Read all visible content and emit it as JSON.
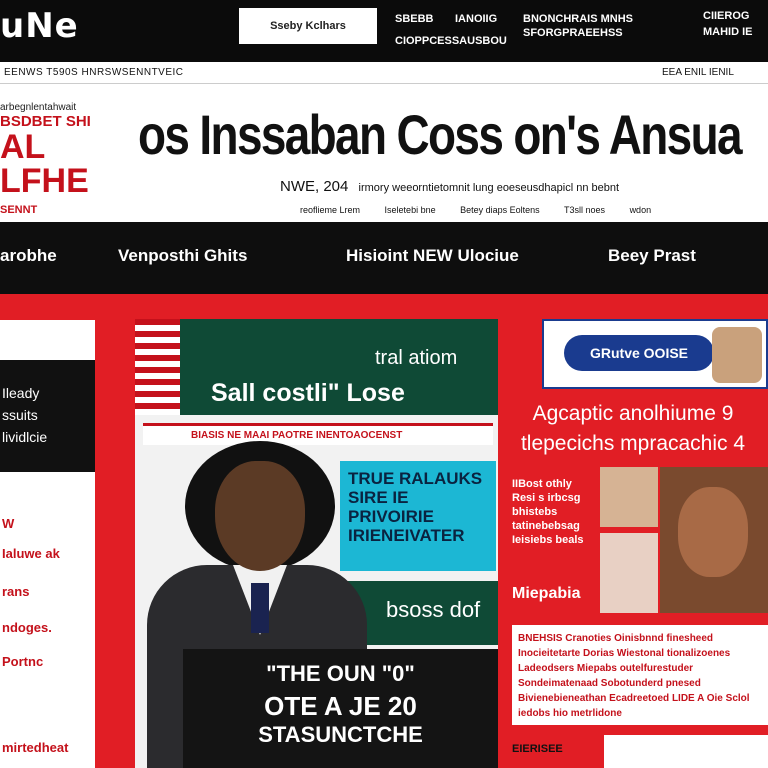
{
  "topbar": {
    "logo": "uNe",
    "search_placeholder": "Sseby Kclhars",
    "links": [
      "SBEBB",
      "IANOIIG",
      "BNONCHRAIS MNHS",
      "SFORGPRAEEHSS",
      "CIOPPCESSAUSBOU"
    ],
    "right": [
      "CIIEROG",
      "MAHID IE"
    ]
  },
  "utility": {
    "left": "EENWS   T590S   HNRSWSENNTVEIC",
    "right": "EEA  ENIL  IENIL"
  },
  "masthead": {
    "brand_small": "arbegnlentahwait",
    "brand_line": "BSDBET SHI",
    "brand_big": "AL LFHE",
    "brand_tag": "SENNT",
    "headline": "os Inssaban Coss on's Ansua",
    "dateline": "NWE, 204",
    "dateline_sub": "irmory weeorntietomnit lung eoeseusdhapicl nn bebnt",
    "sublinks": [
      "reoflieme Lrem",
      "Iseletebi bne",
      "Betey diaps Eoltens",
      "T3sll noes",
      "wdon"
    ]
  },
  "nav": [
    "arobhe",
    "Venposthi Ghits",
    "Hisioint NEW Ulociue",
    "Beey Prast"
  ],
  "left_column": {
    "block_lines": [
      "Ileady",
      "ssuits",
      "lividlcie"
    ],
    "items": [
      "W",
      "Ialuwe ak",
      "rans",
      "ndoges.",
      "Portnc",
      "mirtedheat"
    ]
  },
  "feature": {
    "kicker": "tral atiom",
    "title": "Sall costli\" Lose",
    "strip": "BIASIS NE MAAI PAOTRE   INENTOAOCENST",
    "cyan_text": "TRUE RALAUKS SIRE IE PRIVOIRIE IRIENEIVATER",
    "lower_text": "bsoss dof",
    "caption_1": "\"THE OUN \"0\"",
    "caption_2": "OTE A JE 20",
    "caption_3": "STASUNCTCHE"
  },
  "right_column": {
    "ad_text": "GRutve OOISE",
    "heading_1": "Agcaptic anolhiume 9",
    "heading_2": "tlepecichs mpracachic 4",
    "blurb": [
      "IIBost othly",
      "Resi s irbcsg",
      "bhistebs",
      "tatinebebsag",
      "Ieisiebs beals"
    ],
    "mini_heading": "Miepabia",
    "body": "BNEHSIS Cranoties Oinisbnnd finesheed Inocieitetarte Dorias Wiestonal tionalizoenes Ladeodsers Miepabs outelfurestuder Sondeimatenaad Sobotunderd pnesed Bivienebieneathan Ecadreetoed LIDE A Oie Sclol iedobs hio metrlidone",
    "footer": "EIERISEE"
  }
}
